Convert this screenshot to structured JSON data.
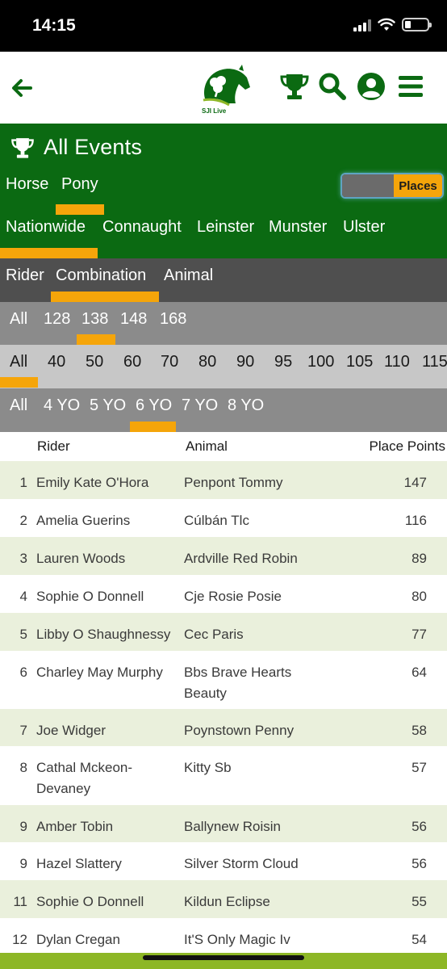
{
  "status": {
    "time": "14:15"
  },
  "header": {
    "logo_text": "SJI Live"
  },
  "page": {
    "title": "All Events"
  },
  "discipline_tabs": [
    "Horse",
    "Pony"
  ],
  "toggle": {
    "label": "Places"
  },
  "region_tabs": [
    "Nationwide",
    "Connaught",
    "Leinster",
    "Munster",
    "Ulster"
  ],
  "type_tabs": [
    "Rider",
    "Combination",
    "Animal"
  ],
  "class_tabs": [
    "All",
    "128",
    "138",
    "148",
    "168"
  ],
  "height_tabs": [
    "All",
    "40",
    "50",
    "60",
    "70",
    "80",
    "90",
    "95",
    "100",
    "105",
    "110",
    "115"
  ],
  "age_tabs": [
    "All",
    "4 YO",
    "5 YO",
    "6 YO",
    "7 YO",
    "8 YO"
  ],
  "table": {
    "headers": {
      "rider": "Rider",
      "animal": "Animal",
      "points": "Place Points"
    },
    "rows": [
      {
        "pos": "1",
        "rider": "Emily Kate O'Hora",
        "animal": "Penpont Tommy",
        "points": "147"
      },
      {
        "pos": "2",
        "rider": "Amelia Guerins",
        "animal": "Cúlbán Tlc",
        "points": "116"
      },
      {
        "pos": "3",
        "rider": "Lauren Woods",
        "animal": "Ardville Red Robin",
        "points": "89"
      },
      {
        "pos": "4",
        "rider": "Sophie O Donnell",
        "animal": "Cje Rosie Posie",
        "points": "80"
      },
      {
        "pos": "5",
        "rider": "Libby O Shaughnessy",
        "animal": "Cec Paris",
        "points": "77"
      },
      {
        "pos": "6",
        "rider": "Charley May Murphy",
        "animal": "Bbs Brave Hearts Beauty",
        "points": "64"
      },
      {
        "pos": "7",
        "rider": "Joe Widger",
        "animal": "Poynstown Penny",
        "points": "58"
      },
      {
        "pos": "8",
        "rider": "Cathal Mckeon-Devaney",
        "animal": "Kitty Sb",
        "points": "57"
      },
      {
        "pos": "9",
        "rider": "Amber Tobin",
        "animal": "Ballynew Roisin",
        "points": "56"
      },
      {
        "pos": "9",
        "rider": "Hazel Slattery",
        "animal": "Silver Storm Cloud",
        "points": "56"
      },
      {
        "pos": "11",
        "rider": "Sophie O Donnell",
        "animal": "Kildun Eclipse",
        "points": "55"
      },
      {
        "pos": "12",
        "rider": "Dylan Cregan",
        "animal": "It'S Only Magic Iv",
        "points": "54"
      }
    ]
  },
  "colors": {
    "brand_green": "#0b6a12",
    "accent_orange": "#f5a50a",
    "row_alt": "#eaf0dc",
    "bottom_strip": "#8db726"
  }
}
